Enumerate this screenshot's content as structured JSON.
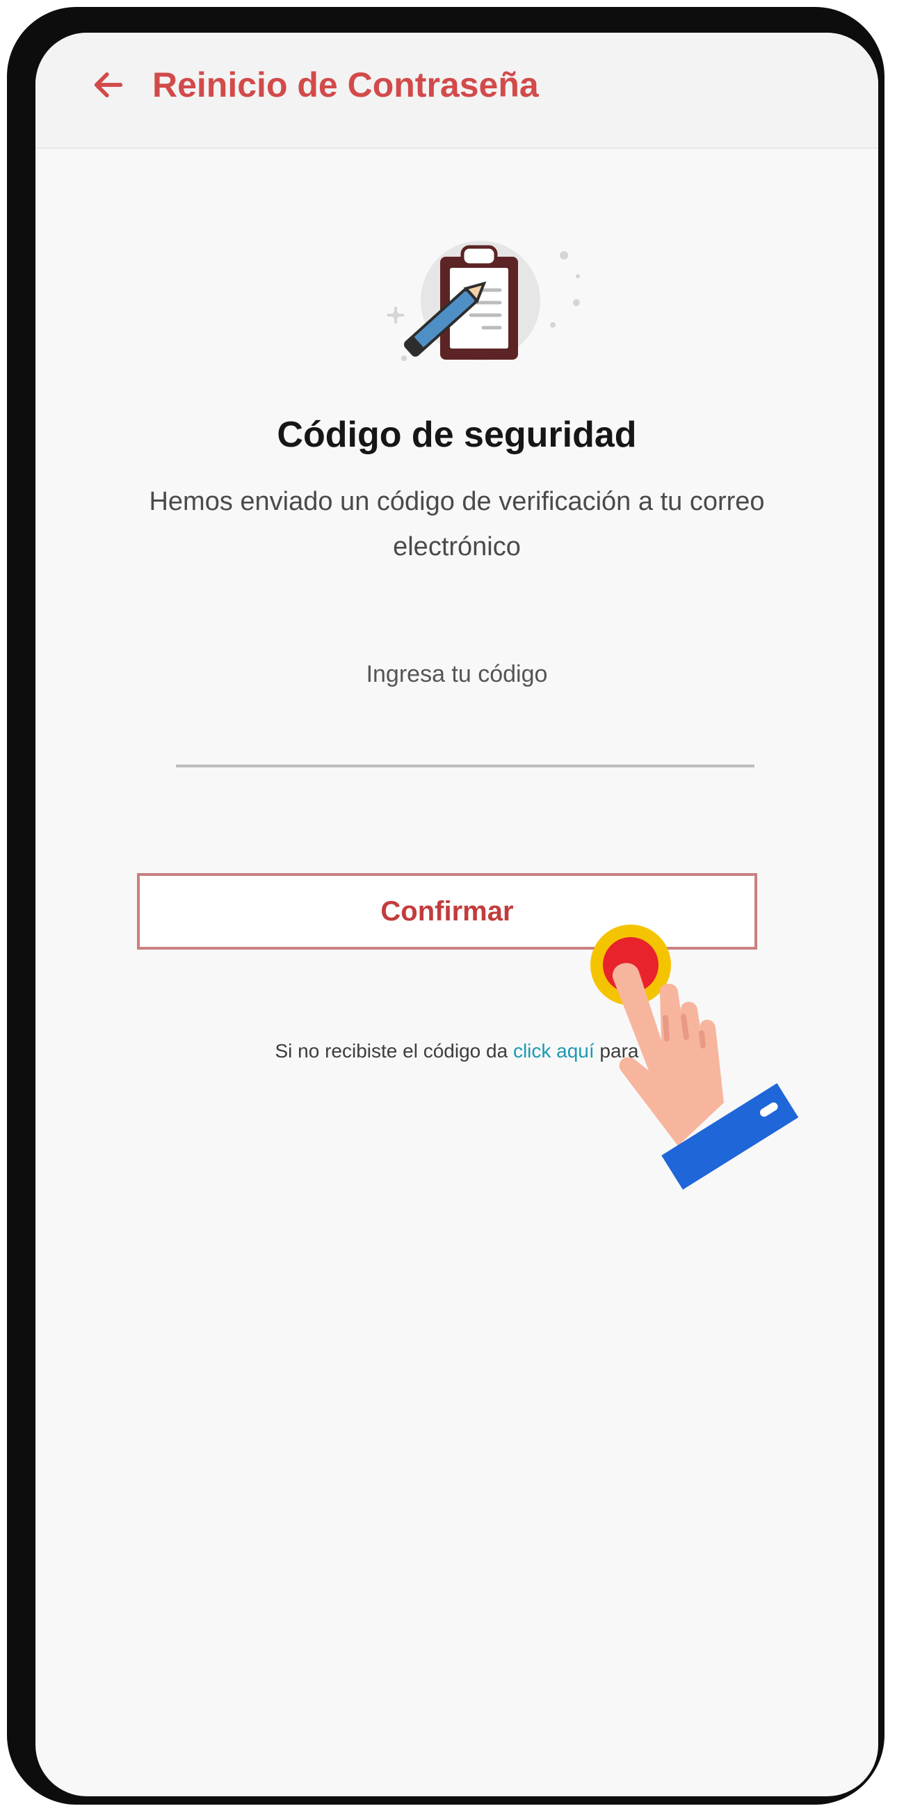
{
  "header": {
    "title": "Reinicio de Contraseña",
    "back_icon": "arrow-left-icon"
  },
  "illustration": {
    "icon": "clipboard-pen-icon"
  },
  "main": {
    "heading": "Código de seguridad",
    "subtext": "Hemos enviado un código de verificación a tu correo electrónico",
    "code_label": "Ingresa tu código",
    "code_value": "",
    "confirm_label": "Confirmar",
    "resend_prefix": "Si no recibiste el código da ",
    "resend_link": "click aquí",
    "resend_suffix": " para"
  },
  "overlay": {
    "icon": "tap-hand-icon"
  },
  "colors": {
    "accent": "#d24a4a",
    "link": "#1b99b0",
    "background": "#f8f8f8",
    "appbar": "#f3f3f3",
    "button_border": "#c98080"
  }
}
